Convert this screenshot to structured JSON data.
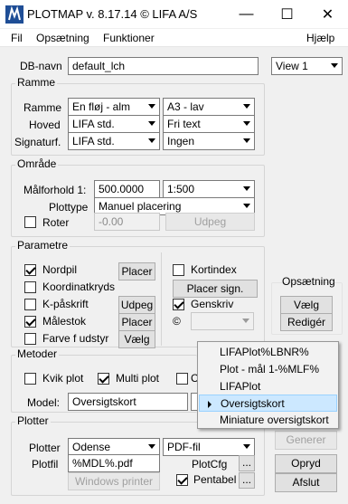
{
  "window": {
    "title": "PLOTMAP v. 8.17.14 © LIFA A/S",
    "minimize": "—",
    "maximize": "☐",
    "close": "✕"
  },
  "menu": {
    "file": "Fil",
    "setup": "Opsætning",
    "functions": "Funktioner",
    "help": "Hjælp"
  },
  "db": {
    "label": "DB-navn",
    "value": "default_lch",
    "view": "View 1"
  },
  "frame": {
    "title": "Ramme",
    "rows": [
      {
        "label": "Ramme",
        "left": "En fløj - alm",
        "right": "A3 - lav"
      },
      {
        "label": "Hoved",
        "left": "LIFA std.",
        "right": "Fri text"
      },
      {
        "label": "Signaturf.",
        "left": "LIFA std.",
        "right": "Ingen"
      }
    ]
  },
  "area": {
    "title": "Område",
    "scale_label": "Målforhold 1:",
    "scale_value": "500.0000",
    "scale_combo": "1:500",
    "plottype_label": "Plottype",
    "plottype": "Manuel placering",
    "rotate_label": "Roter",
    "rotate_value": "-0.00",
    "pick_button": "Udpeg"
  },
  "params": {
    "title": "Parametre",
    "nordpil": "Nordpil",
    "koordinatkryds": "Koordinatkryds",
    "kpaaskrift": "K-påskrift",
    "maalestok": "Målestok",
    "farve": "Farve f udstyr",
    "placer": "Placer",
    "udpeg": "Udpeg",
    "vaelg": "Vælg",
    "kortindex": "Kortindex",
    "placer_sign": "Placer sign.",
    "genskriv": "Genskriv",
    "copyright": "©"
  },
  "setup_group": {
    "title": "Opsætning",
    "choose": "Vælg",
    "edit": "Redigér"
  },
  "methods": {
    "title": "Metoder",
    "kvik": "Kvik plot",
    "multi": "Multi plot",
    "model_label": "Model:",
    "model_value": "Oversigtskort"
  },
  "plotter": {
    "title": "Plotter",
    "plotter_label": "Plotter",
    "plotter_value": "Odense",
    "format": "PDF-fil",
    "file_label": "Plotfil",
    "file_value": "%MDL%.pdf",
    "plotcfg": "PlotCfg",
    "pentabel": "Pentabel",
    "dots": "...",
    "windows_printer": "Windows printer"
  },
  "actions": {
    "generate": "Generer",
    "refresh": "Opryd",
    "close": "Afslut"
  },
  "context_menu": {
    "items": [
      "LIFAPlot%LBNR%",
      "Plot - mål 1-%MLF%",
      "LIFAPlot",
      "Oversigtskort",
      "Miniature oversigtskort"
    ],
    "selected": "Oversigtskort"
  }
}
